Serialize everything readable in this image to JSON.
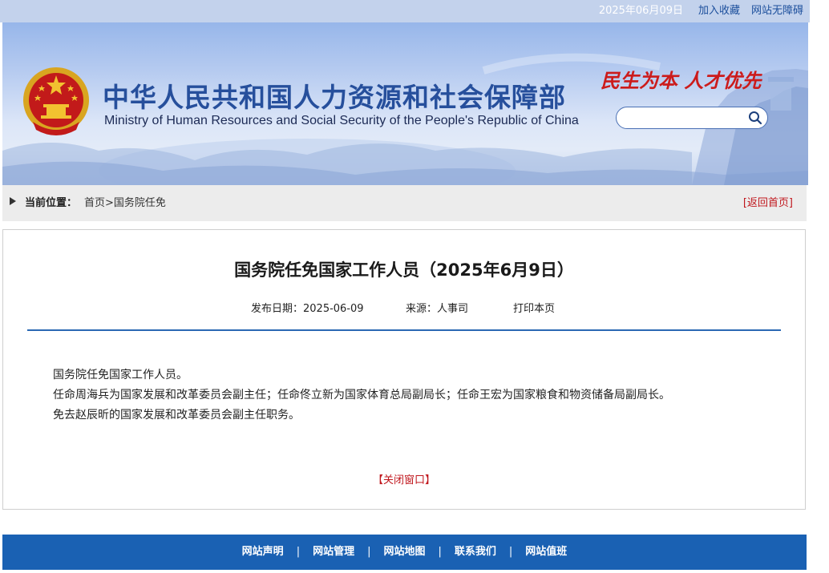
{
  "topbar": {
    "date": "2025年06月09日",
    "add_favorite": "加入收藏",
    "accessibility": "网站无障碍"
  },
  "header": {
    "title_cn": "中华人民共和国人力资源和社会保障部",
    "title_en": "Ministry of Human Resources and Social Security of the People's Republic of China",
    "slogan": "民生为本  人才优先",
    "search": {
      "placeholder": ""
    }
  },
  "breadcrumb": {
    "label": "当前位置：",
    "home": "首页",
    "separator": ">",
    "current": "国务院任免",
    "back_home": "[返回首页]"
  },
  "article": {
    "title": "国务院任免国家工作人员（2025年6月9日）",
    "publish_date_label": "发布日期：",
    "publish_date": "2025-06-09",
    "source_label": "来源：",
    "source": "人事司",
    "print": "打印本页",
    "paragraphs": [
      "国务院任免国家工作人员。",
      "任命周海兵为国家发展和改革委员会副主任；任命佟立新为国家体育总局副局长；任命王宏为国家粮食和物资储备局副局长。",
      "免去赵辰昕的国家发展和改革委员会副主任职务。"
    ],
    "close": "【关闭窗口】"
  },
  "footer": {
    "links": [
      "网站声明",
      "网站管理",
      "网站地图",
      "联系我们",
      "网站值班"
    ],
    "separator": "|"
  },
  "colors": {
    "brand_blue": "#264f9c",
    "accent_red": "#c0161c",
    "footer_blue": "#1a61b3",
    "divider_blue": "#2a68b3"
  },
  "icons": [
    "national-emblem",
    "search-icon",
    "breadcrumb-arrow-icon"
  ]
}
